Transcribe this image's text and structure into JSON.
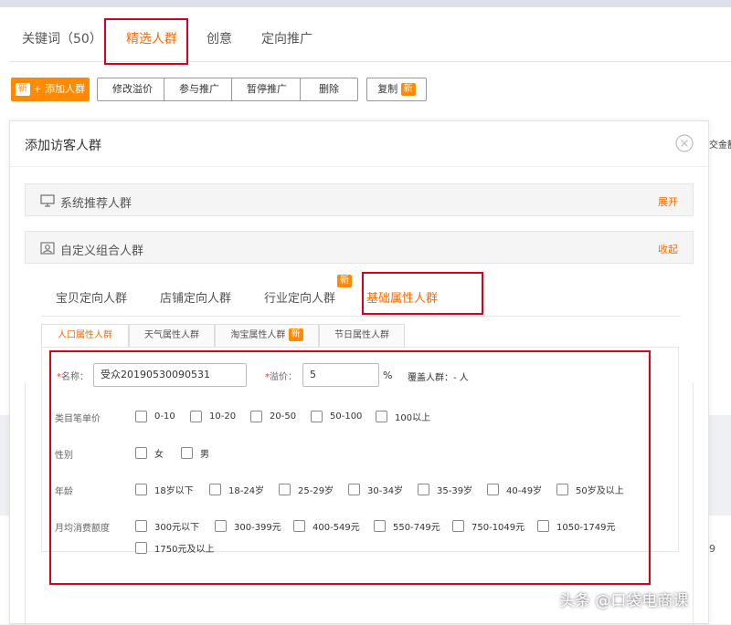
{
  "main_tabs": [
    {
      "label": "关键词（50）"
    },
    {
      "label": "精选人群"
    },
    {
      "label": "创意"
    },
    {
      "label": "定向推广"
    }
  ],
  "toolbar": {
    "add_badge": "新",
    "add_label": "+ 添加人群",
    "modify_bid": "修改溢价",
    "join_promo": "参与推广",
    "pause_promo": "暂停推广",
    "delete": "删除",
    "copy": "复制",
    "copy_badge": "新"
  },
  "side_cut_text": "交金额",
  "side_cut_text2": "9",
  "modal": {
    "title": "添加访客人群",
    "system_panel": {
      "label": "系统推荐人群",
      "action": "展开"
    },
    "custom_panel": {
      "label": "自定义组合人群",
      "action": "收起"
    },
    "sub_tabs": [
      {
        "label": "宝贝定向人群"
      },
      {
        "label": "店铺定向人群"
      },
      {
        "label": "行业定向人群"
      },
      {
        "label": "基础属性人群"
      }
    ],
    "sub_tab_badge": "新",
    "attr_tabs": [
      {
        "label": "人口属性人群"
      },
      {
        "label": "天气属性人群"
      },
      {
        "label": "淘宝属性人群"
      },
      {
        "label": "节日属性人群"
      }
    ],
    "attr_tab_badge": "新",
    "form": {
      "name_label": "名称：",
      "name_value": "受众20190530090531",
      "bid_label": "溢价：",
      "bid_value": "5",
      "bid_unit": "%",
      "coverage": "覆盖人群：- 人",
      "required_mark": "*",
      "price_label": "类目笔单价",
      "price_options": [
        "0-10",
        "10-20",
        "20-50",
        "50-100",
        "100以上"
      ],
      "gender_label": "性别",
      "gender_options": [
        "女",
        "男"
      ],
      "age_label": "年龄",
      "age_options": [
        "18岁以下",
        "18-24岁",
        "25-29岁",
        "30-34岁",
        "35-39岁",
        "40-49岁",
        "50岁及以上"
      ],
      "spend_label": "月均消费额度",
      "spend_options": [
        "300元以下",
        "300-399元",
        "400-549元",
        "550-749元",
        "750-1049元",
        "1050-1749元",
        "1750元及以上"
      ]
    }
  },
  "watermark": "头条 @口袋电商课"
}
